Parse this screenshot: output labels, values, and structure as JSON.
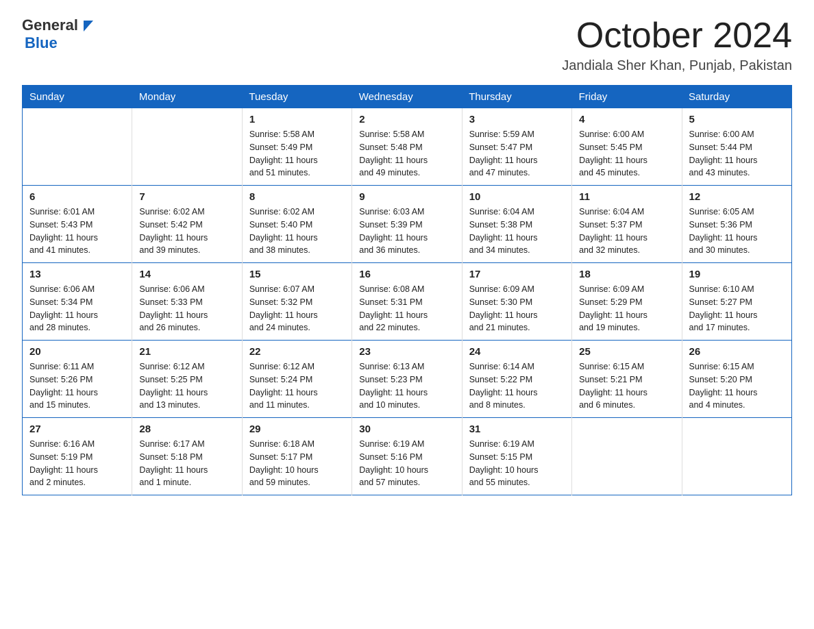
{
  "logo": {
    "general": "General",
    "blue": "Blue"
  },
  "title": {
    "month_year": "October 2024",
    "location": "Jandiala Sher Khan, Punjab, Pakistan"
  },
  "columns": [
    "Sunday",
    "Monday",
    "Tuesday",
    "Wednesday",
    "Thursday",
    "Friday",
    "Saturday"
  ],
  "weeks": [
    [
      {
        "day": "",
        "info": ""
      },
      {
        "day": "",
        "info": ""
      },
      {
        "day": "1",
        "info": "Sunrise: 5:58 AM\nSunset: 5:49 PM\nDaylight: 11 hours\nand 51 minutes."
      },
      {
        "day": "2",
        "info": "Sunrise: 5:58 AM\nSunset: 5:48 PM\nDaylight: 11 hours\nand 49 minutes."
      },
      {
        "day": "3",
        "info": "Sunrise: 5:59 AM\nSunset: 5:47 PM\nDaylight: 11 hours\nand 47 minutes."
      },
      {
        "day": "4",
        "info": "Sunrise: 6:00 AM\nSunset: 5:45 PM\nDaylight: 11 hours\nand 45 minutes."
      },
      {
        "day": "5",
        "info": "Sunrise: 6:00 AM\nSunset: 5:44 PM\nDaylight: 11 hours\nand 43 minutes."
      }
    ],
    [
      {
        "day": "6",
        "info": "Sunrise: 6:01 AM\nSunset: 5:43 PM\nDaylight: 11 hours\nand 41 minutes."
      },
      {
        "day": "7",
        "info": "Sunrise: 6:02 AM\nSunset: 5:42 PM\nDaylight: 11 hours\nand 39 minutes."
      },
      {
        "day": "8",
        "info": "Sunrise: 6:02 AM\nSunset: 5:40 PM\nDaylight: 11 hours\nand 38 minutes."
      },
      {
        "day": "9",
        "info": "Sunrise: 6:03 AM\nSunset: 5:39 PM\nDaylight: 11 hours\nand 36 minutes."
      },
      {
        "day": "10",
        "info": "Sunrise: 6:04 AM\nSunset: 5:38 PM\nDaylight: 11 hours\nand 34 minutes."
      },
      {
        "day": "11",
        "info": "Sunrise: 6:04 AM\nSunset: 5:37 PM\nDaylight: 11 hours\nand 32 minutes."
      },
      {
        "day": "12",
        "info": "Sunrise: 6:05 AM\nSunset: 5:36 PM\nDaylight: 11 hours\nand 30 minutes."
      }
    ],
    [
      {
        "day": "13",
        "info": "Sunrise: 6:06 AM\nSunset: 5:34 PM\nDaylight: 11 hours\nand 28 minutes."
      },
      {
        "day": "14",
        "info": "Sunrise: 6:06 AM\nSunset: 5:33 PM\nDaylight: 11 hours\nand 26 minutes."
      },
      {
        "day": "15",
        "info": "Sunrise: 6:07 AM\nSunset: 5:32 PM\nDaylight: 11 hours\nand 24 minutes."
      },
      {
        "day": "16",
        "info": "Sunrise: 6:08 AM\nSunset: 5:31 PM\nDaylight: 11 hours\nand 22 minutes."
      },
      {
        "day": "17",
        "info": "Sunrise: 6:09 AM\nSunset: 5:30 PM\nDaylight: 11 hours\nand 21 minutes."
      },
      {
        "day": "18",
        "info": "Sunrise: 6:09 AM\nSunset: 5:29 PM\nDaylight: 11 hours\nand 19 minutes."
      },
      {
        "day": "19",
        "info": "Sunrise: 6:10 AM\nSunset: 5:27 PM\nDaylight: 11 hours\nand 17 minutes."
      }
    ],
    [
      {
        "day": "20",
        "info": "Sunrise: 6:11 AM\nSunset: 5:26 PM\nDaylight: 11 hours\nand 15 minutes."
      },
      {
        "day": "21",
        "info": "Sunrise: 6:12 AM\nSunset: 5:25 PM\nDaylight: 11 hours\nand 13 minutes."
      },
      {
        "day": "22",
        "info": "Sunrise: 6:12 AM\nSunset: 5:24 PM\nDaylight: 11 hours\nand 11 minutes."
      },
      {
        "day": "23",
        "info": "Sunrise: 6:13 AM\nSunset: 5:23 PM\nDaylight: 11 hours\nand 10 minutes."
      },
      {
        "day": "24",
        "info": "Sunrise: 6:14 AM\nSunset: 5:22 PM\nDaylight: 11 hours\nand 8 minutes."
      },
      {
        "day": "25",
        "info": "Sunrise: 6:15 AM\nSunset: 5:21 PM\nDaylight: 11 hours\nand 6 minutes."
      },
      {
        "day": "26",
        "info": "Sunrise: 6:15 AM\nSunset: 5:20 PM\nDaylight: 11 hours\nand 4 minutes."
      }
    ],
    [
      {
        "day": "27",
        "info": "Sunrise: 6:16 AM\nSunset: 5:19 PM\nDaylight: 11 hours\nand 2 minutes."
      },
      {
        "day": "28",
        "info": "Sunrise: 6:17 AM\nSunset: 5:18 PM\nDaylight: 11 hours\nand 1 minute."
      },
      {
        "day": "29",
        "info": "Sunrise: 6:18 AM\nSunset: 5:17 PM\nDaylight: 10 hours\nand 59 minutes."
      },
      {
        "day": "30",
        "info": "Sunrise: 6:19 AM\nSunset: 5:16 PM\nDaylight: 10 hours\nand 57 minutes."
      },
      {
        "day": "31",
        "info": "Sunrise: 6:19 AM\nSunset: 5:15 PM\nDaylight: 10 hours\nand 55 minutes."
      },
      {
        "day": "",
        "info": ""
      },
      {
        "day": "",
        "info": ""
      }
    ]
  ]
}
